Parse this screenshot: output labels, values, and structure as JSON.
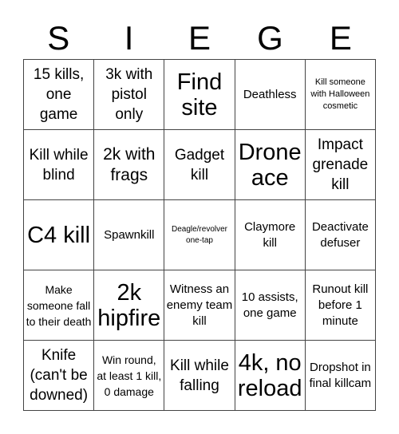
{
  "title_letters": [
    "S",
    "I",
    "E",
    "G",
    "E"
  ],
  "cells": [
    {
      "text": "15 kills, one game",
      "size": "s18"
    },
    {
      "text": "3k with pistol only",
      "size": "s18"
    },
    {
      "text": "Find site",
      "size": "s28"
    },
    {
      "text": "Deathless",
      "size": "s15"
    },
    {
      "text": "Kill someone with Halloween cosmetic",
      "size": "s11"
    },
    {
      "text": "Kill while blind",
      "size": "s18"
    },
    {
      "text": "2k with frags",
      "size": "s22"
    },
    {
      "text": "Gadget kill",
      "size": "s18"
    },
    {
      "text": "Drone ace",
      "size": "s28"
    },
    {
      "text": "Impact grenade kill",
      "size": "s18"
    },
    {
      "text": "C4 kill",
      "size": "s28"
    },
    {
      "text": "Spawnkill",
      "size": "s15"
    },
    {
      "text": "Deagle/revolver one-tap",
      "size": "s10"
    },
    {
      "text": "Claymore kill",
      "size": "s15"
    },
    {
      "text": "Deactivate defuser",
      "size": "s15"
    },
    {
      "text": "Make someone fall to their death",
      "size": "s13"
    },
    {
      "text": "2k hipfire",
      "size": "s28"
    },
    {
      "text": "Witness an enemy team kill",
      "size": "s15"
    },
    {
      "text": "10 assists, one game",
      "size": "s15"
    },
    {
      "text": "Runout kill before 1 minute",
      "size": "s15"
    },
    {
      "text": "Knife (can't be downed)",
      "size": "s18"
    },
    {
      "text": "Win round, at least 1 kill, 0 damage",
      "size": "s13"
    },
    {
      "text": "Kill while falling",
      "size": "s18"
    },
    {
      "text": "4k, no reload",
      "size": "s28"
    },
    {
      "text": "Dropshot in final killcam",
      "size": "s15"
    }
  ]
}
